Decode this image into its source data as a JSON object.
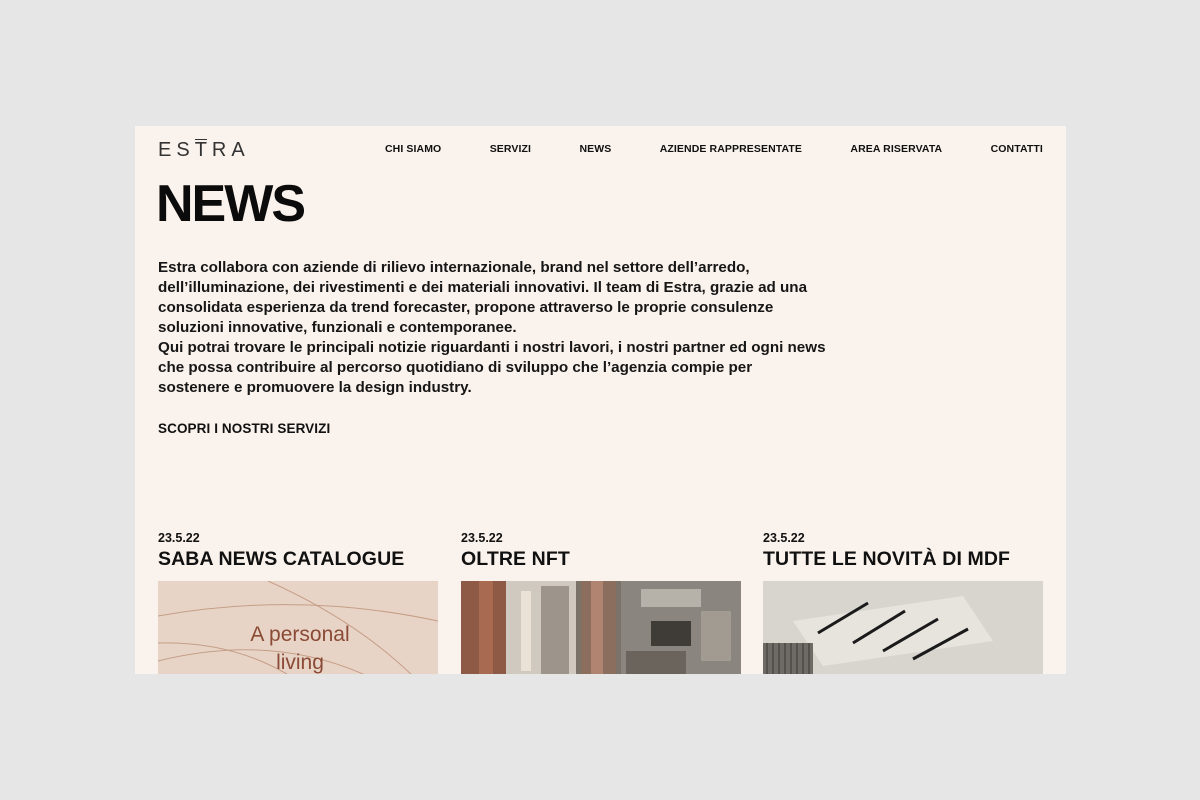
{
  "logo": {
    "e": "ES",
    "t": "T",
    "ra": "RA"
  },
  "nav": {
    "items": [
      "CHI SIAMO",
      "SERVIZI",
      "NEWS",
      "AZIENDE RAPPRESENTATE",
      "AREA RISERVATA",
      "CONTATTI"
    ]
  },
  "page": {
    "title": "NEWS",
    "intro_p1": "Estra collabora con aziende di rilievo internazionale, brand nel settore dell’arredo, dell’illuminazione, dei rivestimenti e dei materiali innovativi. Il team di Estra, grazie ad una consolidata esperienza da trend forecaster, propone attraverso le proprie consulenze soluzioni innovative, funzionali e contemporanee.",
    "intro_p2": "Qui potrai trovare le principali notizie riguardanti i nostri lavori, i nostri partner ed ogni news che possa contribuire al percorso quotidiano di sviluppo che l’agenzia compie per sostenere e promuovere la design industry.",
    "cta": "SCOPRI I NOSTRI SERVIZI"
  },
  "news": [
    {
      "date": "23.5.22",
      "title": "SABA NEWS CATALOGUE",
      "image_text": "A personal living"
    },
    {
      "date": "23.5.22",
      "title": "OLTRE NFT"
    },
    {
      "date": "23.5.22",
      "title": "TUTTE LE NOVITÀ DI MDF"
    }
  ],
  "colors": {
    "background": "#e6e6e6",
    "page": "#faf2ec",
    "text": "#111111",
    "accent_brown": "#8a4a35"
  }
}
